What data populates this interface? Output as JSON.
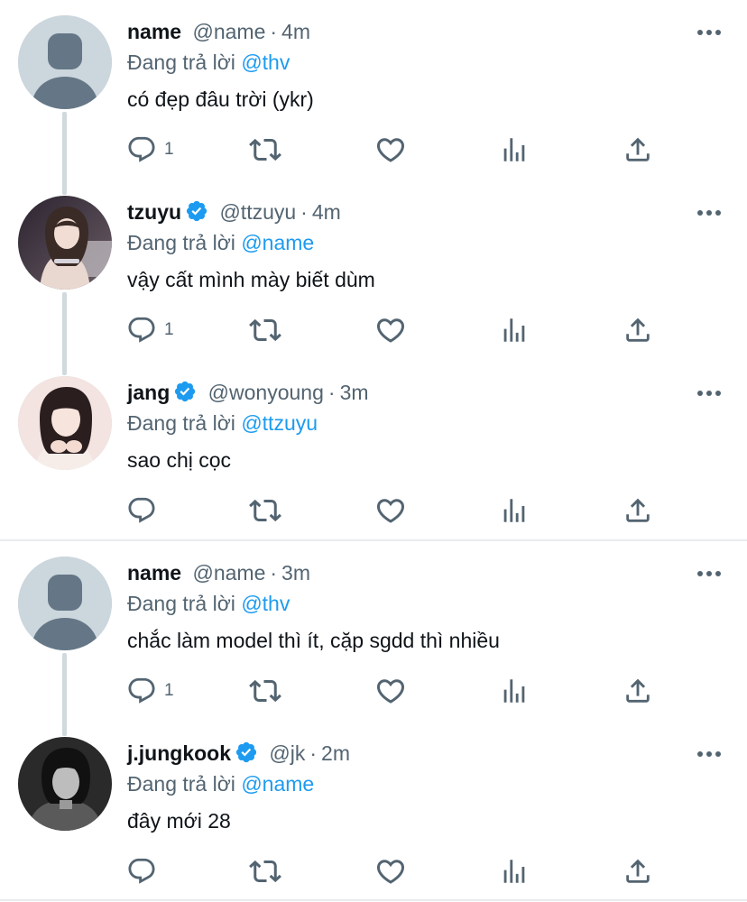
{
  "reply_prefix": "Đang trả lời",
  "icons": {
    "reply": "reply-icon",
    "retweet": "retweet-icon",
    "like": "like-icon",
    "analytics": "analytics-icon",
    "share": "share-icon",
    "more": "more-icon",
    "verified": "verified-badge-icon"
  },
  "colors": {
    "text": "#0f1419",
    "muted": "#536471",
    "link": "#1d9bf0",
    "verified": "#1d9bf0",
    "thread_line": "#cfd9de"
  },
  "tweets": [
    {
      "name": "name",
      "handle": "@name",
      "dot": "·",
      "time": "4m",
      "verified": false,
      "reply_to": "@thv",
      "text": "có đẹp đâu trời (ykr)",
      "reply_count": "1",
      "avatar": "default"
    },
    {
      "name": "tzuyu",
      "handle": "@ttzuyu",
      "dot": "·",
      "time": "4m",
      "verified": true,
      "reply_to": "@name",
      "text": "vậy cất mình mày biết dùm",
      "reply_count": "1",
      "avatar": "photo"
    },
    {
      "name": "jang",
      "handle": "@wonyoung",
      "dot": "·",
      "time": "3m",
      "verified": true,
      "reply_to": "@ttzuyu",
      "text": "sao chị cọc",
      "reply_count": "",
      "avatar": "photo"
    },
    {
      "name": "name",
      "handle": "@name",
      "dot": "·",
      "time": "3m",
      "verified": false,
      "reply_to": "@thv",
      "text": "chắc làm model thì ít, cặp sgdd thì nhiều",
      "reply_count": "1",
      "avatar": "default"
    },
    {
      "name": "j.jungkook",
      "handle": "@jk",
      "dot": "·",
      "time": "2m",
      "verified": true,
      "reply_to": "@name",
      "text": "đây mới 28",
      "reply_count": "",
      "avatar": "photo"
    }
  ]
}
